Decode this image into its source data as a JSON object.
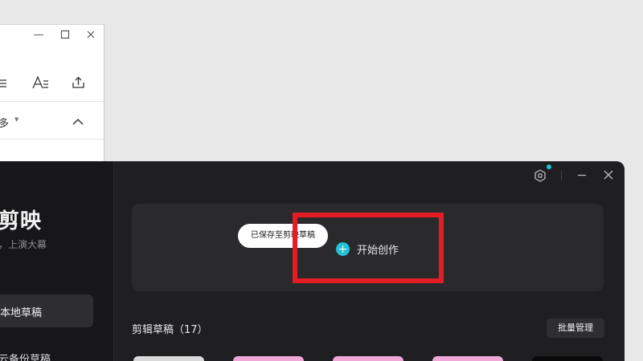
{
  "background_window": {
    "more_label": "多",
    "icons": [
      "minimize-icon",
      "maximize-icon",
      "close-icon",
      "list-icon",
      "text-format-icon",
      "share-icon",
      "caret-down-icon",
      "chevron-up-icon"
    ]
  },
  "app": {
    "brand": "剪映",
    "slogan": "，上演大幕",
    "nav": {
      "local_drafts": "本地草稿",
      "cloud_drafts": "云备份草稿"
    },
    "window_controls": [
      "settings-icon",
      "minimize-icon",
      "close-icon"
    ],
    "notification_dot_color": "#19c4d6",
    "hero": {
      "toast": "已保存至剪映草稿",
      "start_label": "开始创作"
    },
    "drafts_section": {
      "title": "剪辑草稿（17）",
      "batch_button": "批量管理"
    },
    "thumbnail_count": 5
  },
  "colors": {
    "accent": "#22c3d6",
    "highlight_box": "#e41d25",
    "app_background": "#1f1f22",
    "card_background": "#2a2a2d"
  }
}
